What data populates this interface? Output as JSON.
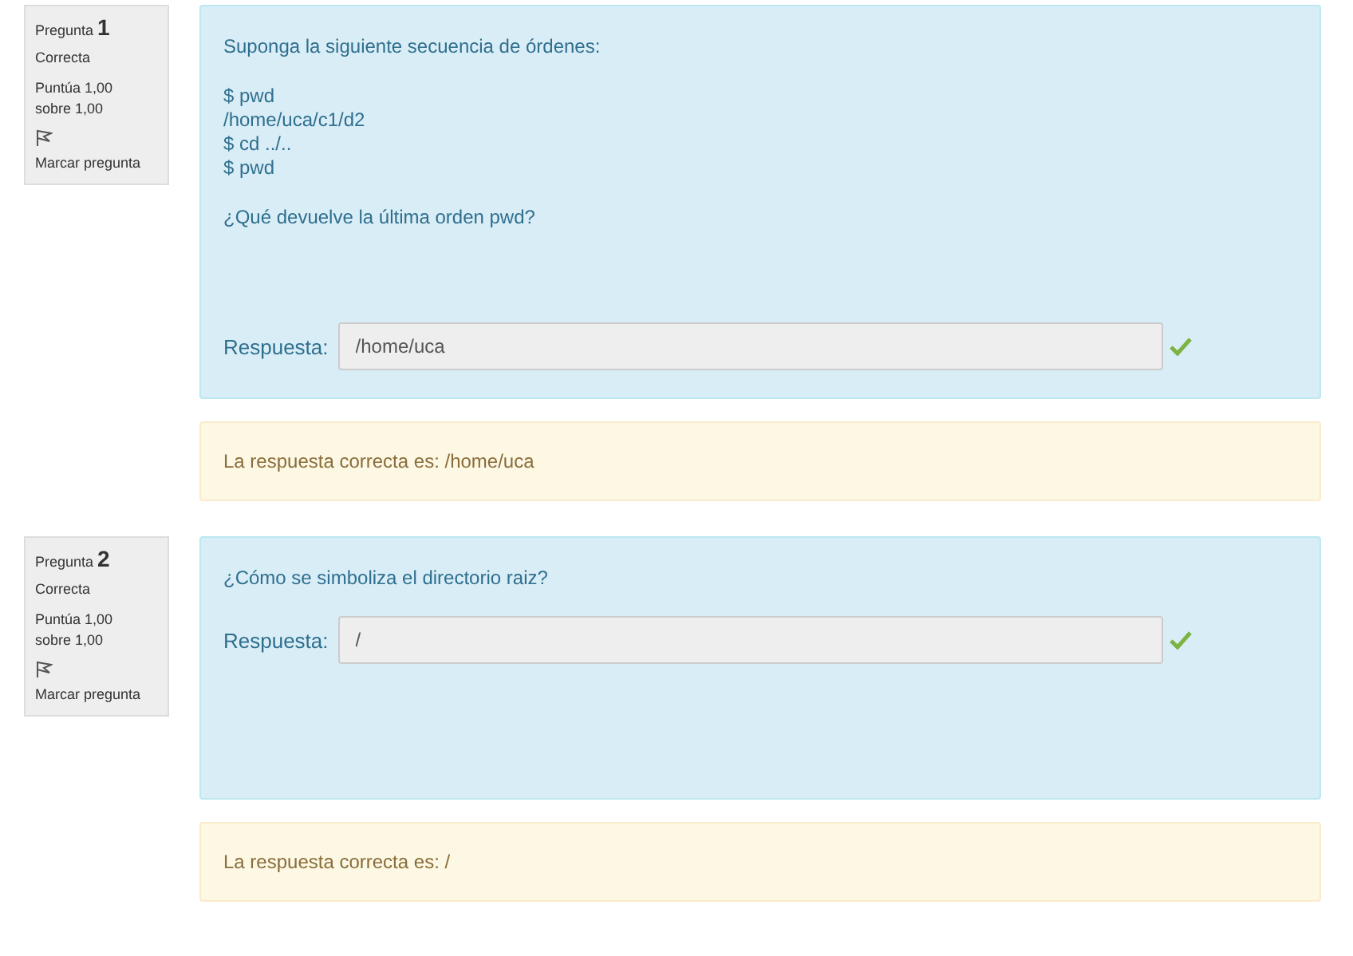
{
  "questions": [
    {
      "label": "Pregunta",
      "number": "1",
      "status": "Correcta",
      "score": [
        "Puntúa 1,00",
        "sobre 1,00"
      ],
      "flag_label": "Marcar pregunta",
      "flagged": false,
      "paragraphs": [
        [
          "Suponga la siguiente secuencia de órdenes:"
        ],
        [
          "$ pwd",
          "/home/uca/c1/d2",
          "$ cd ../..",
          "$ pwd"
        ],
        [
          "¿Qué devuelve la última orden pwd?"
        ]
      ],
      "answer_label": "Respuesta:",
      "answer": "/home/uca",
      "correct": true,
      "feedback": "La respuesta correcta es: /home/uca"
    },
    {
      "label": "Pregunta",
      "number": "2",
      "status": "Correcta",
      "score": [
        "Puntúa 1,00",
        "sobre 1,00"
      ],
      "flag_label": "Marcar pregunta",
      "flagged": false,
      "paragraphs": [
        [
          "¿Cómo se simboliza el directorio raiz?"
        ]
      ],
      "answer_label": "Respuesta:",
      "answer": "/",
      "correct": true,
      "feedback": "La respuesta correcta es: /"
    }
  ]
}
